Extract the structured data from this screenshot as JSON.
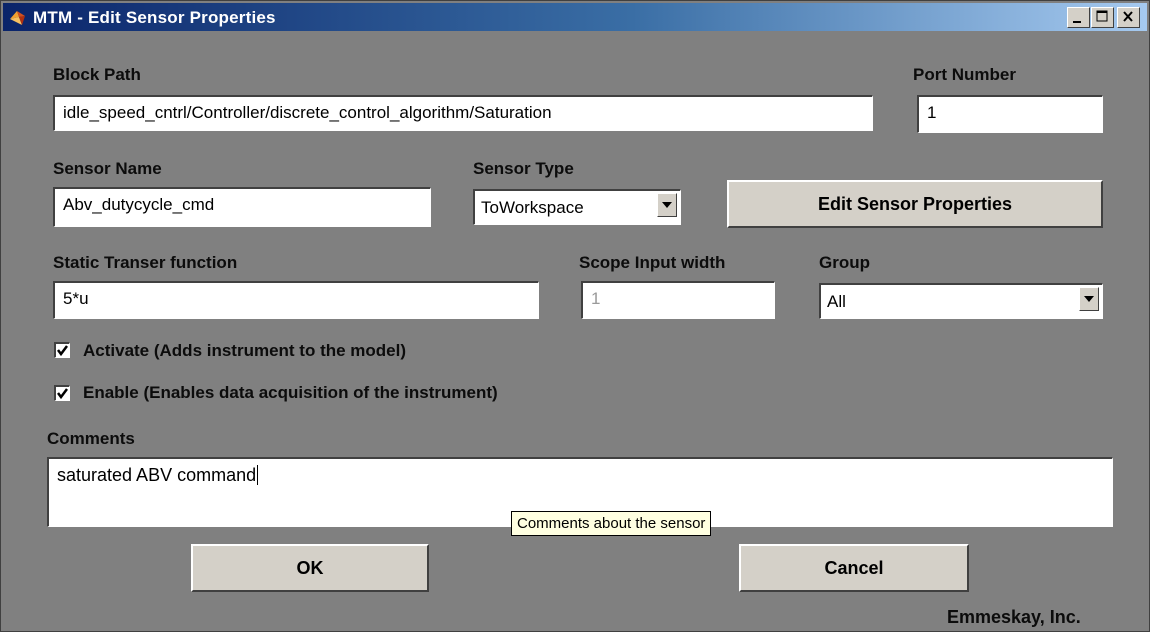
{
  "window": {
    "title": "MTM - Edit Sensor Properties",
    "controls": [
      "minimize",
      "maximize",
      "close"
    ]
  },
  "block_path": {
    "label": "Block Path",
    "value": "idle_speed_cntrl/Controller/discrete_control_algorithm/Saturation"
  },
  "port_number": {
    "label": "Port Number",
    "value": "1"
  },
  "sensor_name": {
    "label": "Sensor Name",
    "value": "Abv_dutycycle_cmd"
  },
  "sensor_type": {
    "label": "Sensor Type",
    "selected": "ToWorkspace"
  },
  "edit_sensor_button": {
    "label": "Edit Sensor Properties"
  },
  "static_transfer": {
    "label": "Static Transer function",
    "value": "5*u"
  },
  "scope_input_width": {
    "label": "Scope Input width",
    "value": "1",
    "disabled": true
  },
  "group": {
    "label": "Group",
    "selected": "All"
  },
  "activate": {
    "label": "Activate (Adds instrument to the model)",
    "checked": true
  },
  "enable": {
    "label": "Enable (Enables data acquisition of the instrument)",
    "checked": true
  },
  "comments": {
    "label": "Comments",
    "value": "saturated ABV command",
    "tooltip": "Comments about the sensor"
  },
  "buttons": {
    "ok": "OK",
    "cancel": "Cancel"
  },
  "footer": {
    "company": "Emmeskay, Inc."
  },
  "colors": {
    "dialog_background": "#808080",
    "title_gradient_start": "#0a246a",
    "title_gradient_end": "#a6caf0",
    "button_face": "#d4d0c8",
    "tooltip_background": "#ffffe1"
  }
}
